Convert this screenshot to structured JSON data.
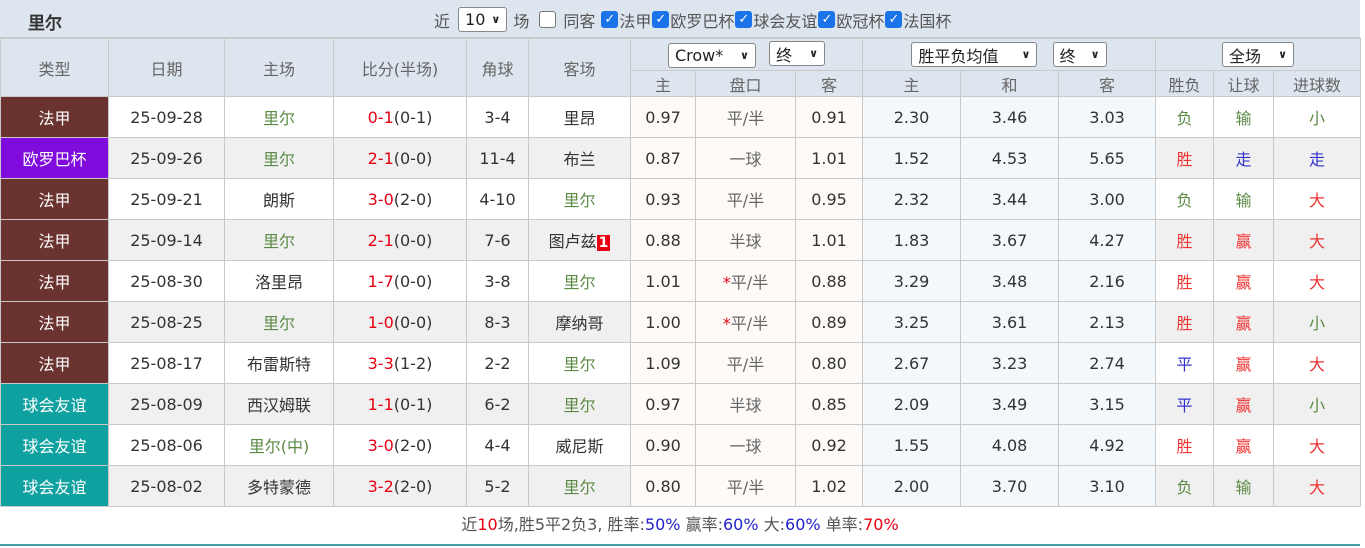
{
  "header": {
    "title": "里尔",
    "recent_label": "近",
    "recent_count": "10",
    "games_label": "场",
    "same_home_label": "同客",
    "same_home_checked": false,
    "competitions": [
      {
        "label": "法甲",
        "checked": true
      },
      {
        "label": "欧罗巴杯",
        "checked": true
      },
      {
        "label": "球会友谊",
        "checked": true
      },
      {
        "label": "欧冠杯",
        "checked": true
      },
      {
        "label": "法国杯",
        "checked": true
      }
    ]
  },
  "columns": {
    "type": "类型",
    "date": "日期",
    "home": "主场",
    "score": "比分(半场)",
    "corner": "角球",
    "away": "客场",
    "ah_company": "Crow*",
    "ah_stage": "终",
    "eu_type": "胜平负均值",
    "eu_stage": "终",
    "period": "全场",
    "ah_home": "主",
    "ah_line": "盘口",
    "ah_away": "客",
    "eu_home": "主",
    "eu_draw": "和",
    "eu_away": "客",
    "res_wl": "胜负",
    "res_ah": "让球",
    "res_ou": "进球数"
  },
  "colors": {
    "法甲": "#6b3330",
    "欧罗巴杯": "#7f0bdc",
    "球会友谊": "#0ea19f",
    "win": "#e33",
    "lose": "#5b8a45",
    "draw": "#3333cc"
  },
  "rows": [
    {
      "type": "法甲",
      "date": "25-09-28",
      "home": "里尔",
      "home_is_team": true,
      "ft": "0-1",
      "ht": "(0-1)",
      "corner": "3-4",
      "away": "里昂",
      "away_is_team": false,
      "red_card": "",
      "ah_home": "0.97",
      "ah_line": "平/半",
      "ah_star": "",
      "ah_away": "0.91",
      "eu_home": "2.30",
      "eu_draw": "3.46",
      "eu_away": "3.03",
      "wl": "负",
      "ah": "输",
      "ou": "小"
    },
    {
      "type": "欧罗巴杯",
      "date": "25-09-26",
      "home": "里尔",
      "home_is_team": true,
      "ft": "2-1",
      "ht": "(0-0)",
      "corner": "11-4",
      "away": "布兰",
      "away_is_team": false,
      "red_card": "",
      "ah_home": "0.87",
      "ah_line": "一球",
      "ah_star": "",
      "ah_away": "1.01",
      "eu_home": "1.52",
      "eu_draw": "4.53",
      "eu_away": "5.65",
      "wl": "胜",
      "ah": "走",
      "ou": "走"
    },
    {
      "type": "法甲",
      "date": "25-09-21",
      "home": "朗斯",
      "home_is_team": false,
      "ft": "3-0",
      "ht": "(2-0)",
      "corner": "4-10",
      "away": "里尔",
      "away_is_team": true,
      "red_card": "",
      "ah_home": "0.93",
      "ah_line": "平/半",
      "ah_star": "",
      "ah_away": "0.95",
      "eu_home": "2.32",
      "eu_draw": "3.44",
      "eu_away": "3.00",
      "wl": "负",
      "ah": "输",
      "ou": "大"
    },
    {
      "type": "法甲",
      "date": "25-09-14",
      "home": "里尔",
      "home_is_team": true,
      "ft": "2-1",
      "ht": "(0-0)",
      "corner": "7-6",
      "away": "图卢兹",
      "away_is_team": false,
      "red_card": "1",
      "ah_home": "0.88",
      "ah_line": "半球",
      "ah_star": "",
      "ah_away": "1.01",
      "eu_home": "1.83",
      "eu_draw": "3.67",
      "eu_away": "4.27",
      "wl": "胜",
      "ah": "赢",
      "ou": "大"
    },
    {
      "type": "法甲",
      "date": "25-08-30",
      "home": "洛里昂",
      "home_is_team": false,
      "ft": "1-7",
      "ht": "(0-0)",
      "corner": "3-8",
      "away": "里尔",
      "away_is_team": true,
      "red_card": "",
      "ah_home": "1.01",
      "ah_line": "平/半",
      "ah_star": "*",
      "ah_away": "0.88",
      "eu_home": "3.29",
      "eu_draw": "3.48",
      "eu_away": "2.16",
      "wl": "胜",
      "ah": "赢",
      "ou": "大"
    },
    {
      "type": "法甲",
      "date": "25-08-25",
      "home": "里尔",
      "home_is_team": true,
      "ft": "1-0",
      "ht": "(0-0)",
      "corner": "8-3",
      "away": "摩纳哥",
      "away_is_team": false,
      "red_card": "",
      "ah_home": "1.00",
      "ah_line": "平/半",
      "ah_star": "*",
      "ah_away": "0.89",
      "eu_home": "3.25",
      "eu_draw": "3.61",
      "eu_away": "2.13",
      "wl": "胜",
      "ah": "赢",
      "ou": "小"
    },
    {
      "type": "法甲",
      "date": "25-08-17",
      "home": "布雷斯特",
      "home_is_team": false,
      "ft": "3-3",
      "ht": "(1-2)",
      "corner": "2-2",
      "away": "里尔",
      "away_is_team": true,
      "red_card": "",
      "ah_home": "1.09",
      "ah_line": "平/半",
      "ah_star": "",
      "ah_away": "0.80",
      "eu_home": "2.67",
      "eu_draw": "3.23",
      "eu_away": "2.74",
      "wl": "平",
      "ah": "赢",
      "ou": "大"
    },
    {
      "type": "球会友谊",
      "date": "25-08-09",
      "home": "西汉姆联",
      "home_is_team": false,
      "ft": "1-1",
      "ht": "(0-1)",
      "corner": "6-2",
      "away": "里尔",
      "away_is_team": true,
      "red_card": "",
      "ah_home": "0.97",
      "ah_line": "半球",
      "ah_star": "",
      "ah_away": "0.85",
      "eu_home": "2.09",
      "eu_draw": "3.49",
      "eu_away": "3.15",
      "wl": "平",
      "ah": "赢",
      "ou": "小"
    },
    {
      "type": "球会友谊",
      "date": "25-08-06",
      "home": "里尔(中)",
      "home_is_team": true,
      "ft": "3-0",
      "ht": "(2-0)",
      "corner": "4-4",
      "away": "威尼斯",
      "away_is_team": false,
      "red_card": "",
      "ah_home": "0.90",
      "ah_line": "一球",
      "ah_star": "",
      "ah_away": "0.92",
      "eu_home": "1.55",
      "eu_draw": "4.08",
      "eu_away": "4.92",
      "wl": "胜",
      "ah": "赢",
      "ou": "大"
    },
    {
      "type": "球会友谊",
      "date": "25-08-02",
      "home": "多特蒙德",
      "home_is_team": false,
      "ft": "3-2",
      "ht": "(2-0)",
      "corner": "5-2",
      "away": "里尔",
      "away_is_team": true,
      "red_card": "",
      "ah_home": "0.80",
      "ah_line": "平/半",
      "ah_star": "",
      "ah_away": "1.02",
      "eu_home": "2.00",
      "eu_draw": "3.70",
      "eu_away": "3.10",
      "wl": "负",
      "ah": "输",
      "ou": "大"
    }
  ],
  "summary": {
    "p1": "近",
    "games": "10",
    "p2": "场,胜5平2负3, 胜率:",
    "win_rate": "50%",
    "p3": " 赢率:",
    "ah_rate": "60%",
    "p4": " 大:",
    "over_rate": "60%",
    "p5": " 单率:",
    "odd_rate": "70%"
  }
}
